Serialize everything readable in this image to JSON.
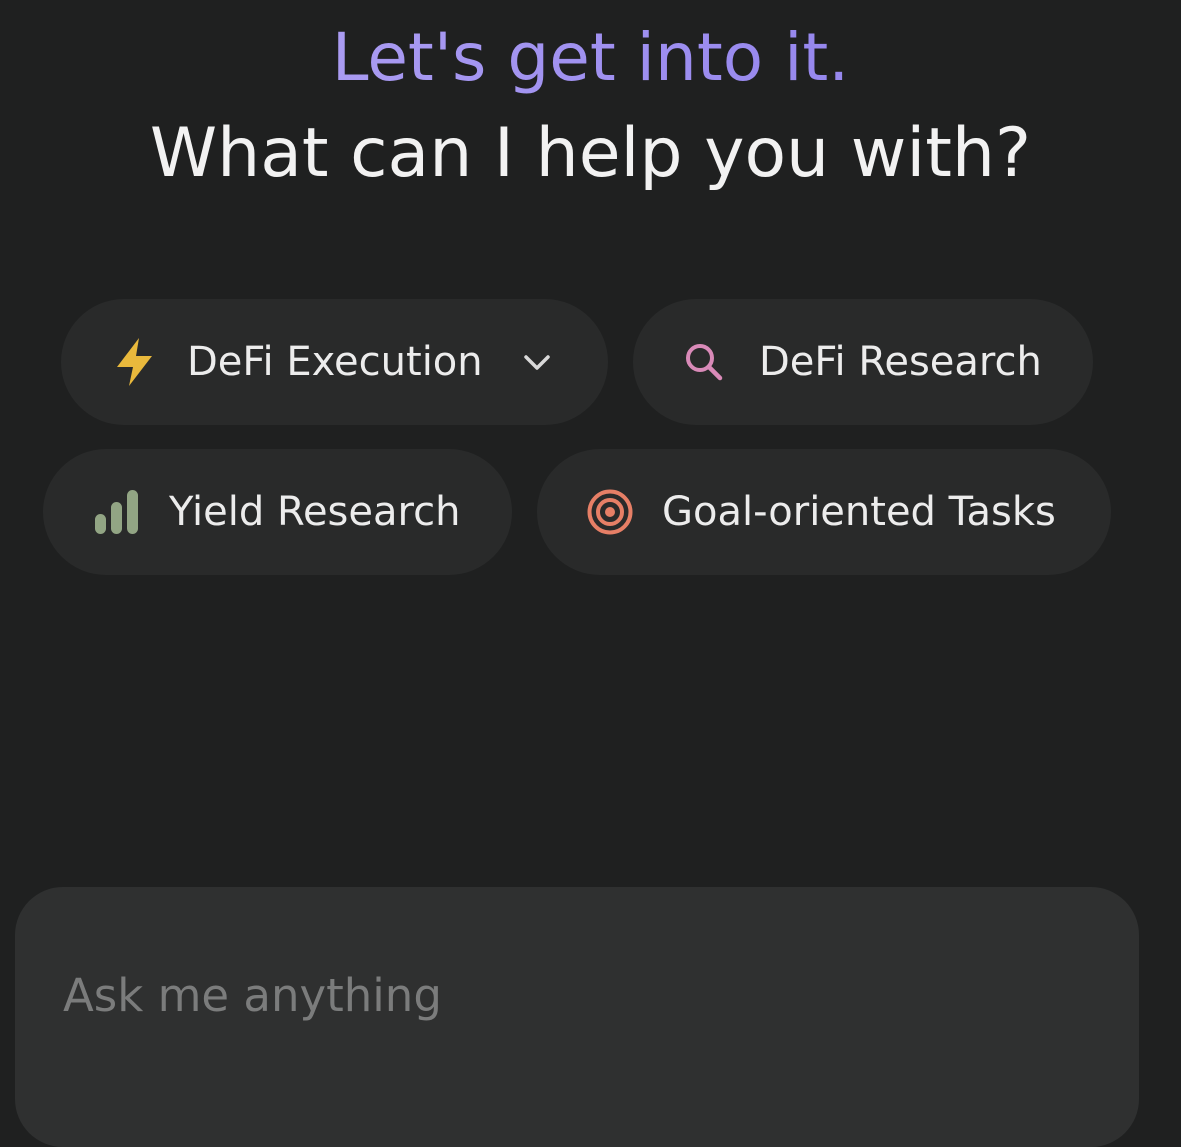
{
  "hero": {
    "greeting": "Let's get into it.",
    "question": "What can I help you with?"
  },
  "chips": [
    {
      "label": "DeFi Execution",
      "icon": "lightning-bolt-icon",
      "icon_color": "#e9b93c",
      "has_dropdown": true
    },
    {
      "label": "DeFi Research",
      "icon": "search-icon",
      "icon_color": "#d98ab8"
    },
    {
      "label": "Yield Research",
      "icon": "bar-chart-icon",
      "icon_color": "#92a584"
    },
    {
      "label": "Goal-oriented Tasks",
      "icon": "target-icon",
      "icon_color": "#e67f66"
    }
  ],
  "composer": {
    "placeholder": "Ask me anything",
    "value": ""
  },
  "colors": {
    "background": "#1f2020",
    "chip_background": "#292a2a",
    "composer_background": "#2f3030",
    "greeting_gradient_start": "#b6a8f3",
    "greeting_gradient_end": "#8778e8"
  }
}
